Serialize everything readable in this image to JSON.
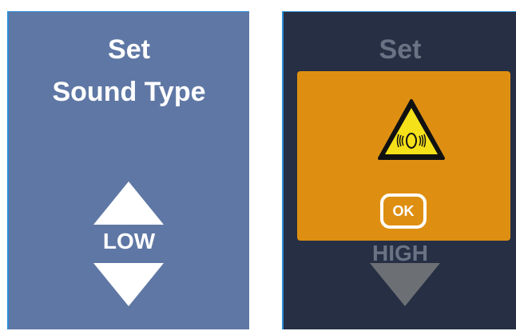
{
  "left_panel": {
    "title_line1": "Set",
    "title_line2": "Sound Type",
    "level": "LOW",
    "colors": {
      "background": "#5f77a4",
      "text": "#ffffff"
    }
  },
  "right_panel": {
    "title_line1": "Set",
    "level": "HIGH",
    "colors": {
      "background": "#262f43",
      "muted_text": "#6a7384"
    }
  },
  "warning_dialog": {
    "icon": "hearing-warning-icon",
    "ok_label": "OK",
    "colors": {
      "background": "#de8f12",
      "icon_fill": "#f5e11a"
    }
  }
}
